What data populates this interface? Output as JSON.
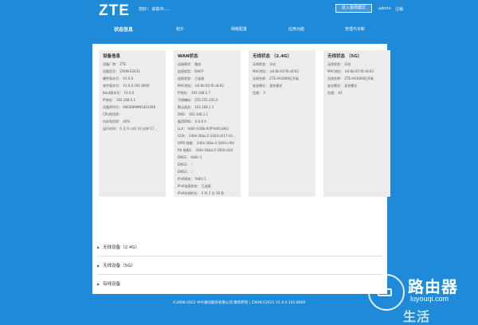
{
  "header": {
    "logo": "ZTE",
    "greeting": "您好！ 获取中.....",
    "mode_button": "进入极简模式",
    "user": "admin",
    "logout": "注销"
  },
  "nav": [
    "状态信息",
    "拓扑",
    "网络配置",
    "应用功能",
    "管理与诊断"
  ],
  "cards": [
    {
      "title": "设备信息",
      "rows": [
        "设备厂商： ZTE",
        "设备型号： ZXHN E2631",
        "硬件版本号： V1.0.0",
        "软件版本号： V1.0.0.181.8000",
        "Boot版本号： V1.0.0",
        "IP地址： 192.168.5.1",
        "设备序列号： HN5EN9MN5401586",
        "CPU利用率：",
        "内存利用率： 40%",
        "运行时间： 0 天 0 小时 10 分钟 57..."
      ]
    },
    {
      "title": "WAN状态",
      "rows": [
        "连接模式： 路由",
        "连接类型： DHCP",
        "连接状态： 已连接",
        "MAC地址： b0:6b:92:f0:c8:62",
        "IP地址： 192.168.1.7",
        "子网掩码： 255.255.255.0",
        "默认网关： 192.168.1.1",
        "DNS： 192.168.1.1",
        "备用DNS： 0.0.0.0",
        "LLA： fe80::b28b:92ff:fef0:c862",
        "GUA： 240e:36ba:2:3404:e517:e5...",
        "IAPD 前缀： 240e:36ba:2:3404:c/64",
        "RA 前缀1： 240e:36ba:2:3400:c/64",
        "DNS1： fe80::1",
        "DNS2： ::",
        "DNS3： ::",
        "IPv6网关： fe80::1",
        "IPv6连接状态： 已连接",
        "IPv6在线时长： 0 时 2 分 16 秒"
      ]
    },
    {
      "title": "无线状态 （2.4G）",
      "rows": [
        "无线状态： 开启",
        "MAC地址： b0:6b:92:f0:c8:62",
        "无线名称： ZTE-AX3000近开板",
        "安全模式： 混合模式",
        "信道： 3"
      ]
    },
    {
      "title": "无线状态 （5G）",
      "rows": [
        "无线状态： 开启",
        "MAC地址： b0:6b:92:f0:c8:63",
        "无线名称： ZTE-AX3000近开板",
        "安全模式： 混合模式",
        "信道： 44"
      ]
    }
  ],
  "sections": [
    "无线设备（2.4G）",
    "无线设备（5G）",
    "有线设备"
  ],
  "footer": "©2008-2022 中兴通讯股份有限公司 版权所有  |  ZXHN E2631 V1.0.0.181.8000",
  "watermark": {
    "title": "路由器",
    "url": "luyouqi.com",
    "bottom": "生活"
  },
  "colors": {
    "background": "#1e8ad8",
    "panel": "#ffffff",
    "card": "#ececec"
  }
}
